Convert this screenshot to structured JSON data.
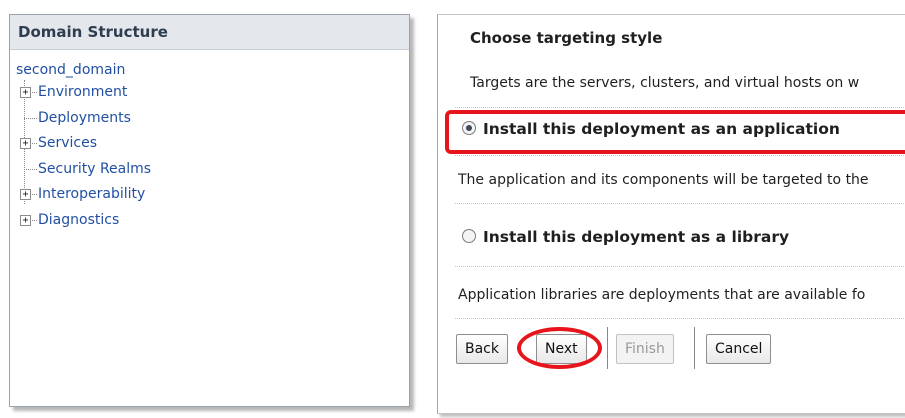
{
  "domain_structure": {
    "title": "Domain Structure",
    "root": "second_domain",
    "items": [
      {
        "label": "Environment",
        "expander": "+"
      },
      {
        "label": "Deployments",
        "expander": ""
      },
      {
        "label": "Services",
        "expander": "+"
      },
      {
        "label": "Security Realms",
        "expander": ""
      },
      {
        "label": "Interoperability",
        "expander": "+"
      },
      {
        "label": "Diagnostics",
        "expander": "+"
      }
    ]
  },
  "targeting": {
    "title": "Choose targeting style",
    "description": "Targets are the servers, clusters, and virtual hosts on w",
    "options": [
      {
        "label": "Install this deployment as an application",
        "checked": true,
        "detail": "The application and its components will be targeted to the"
      },
      {
        "label": "Install this deployment as a library",
        "checked": false,
        "detail": "Application libraries are deployments that are available fo"
      }
    ]
  },
  "buttons": {
    "back": "Back",
    "next": "Next",
    "finish": "Finish",
    "cancel": "Cancel"
  },
  "colors": {
    "highlight": "#e8141c",
    "link": "#2150a3"
  }
}
